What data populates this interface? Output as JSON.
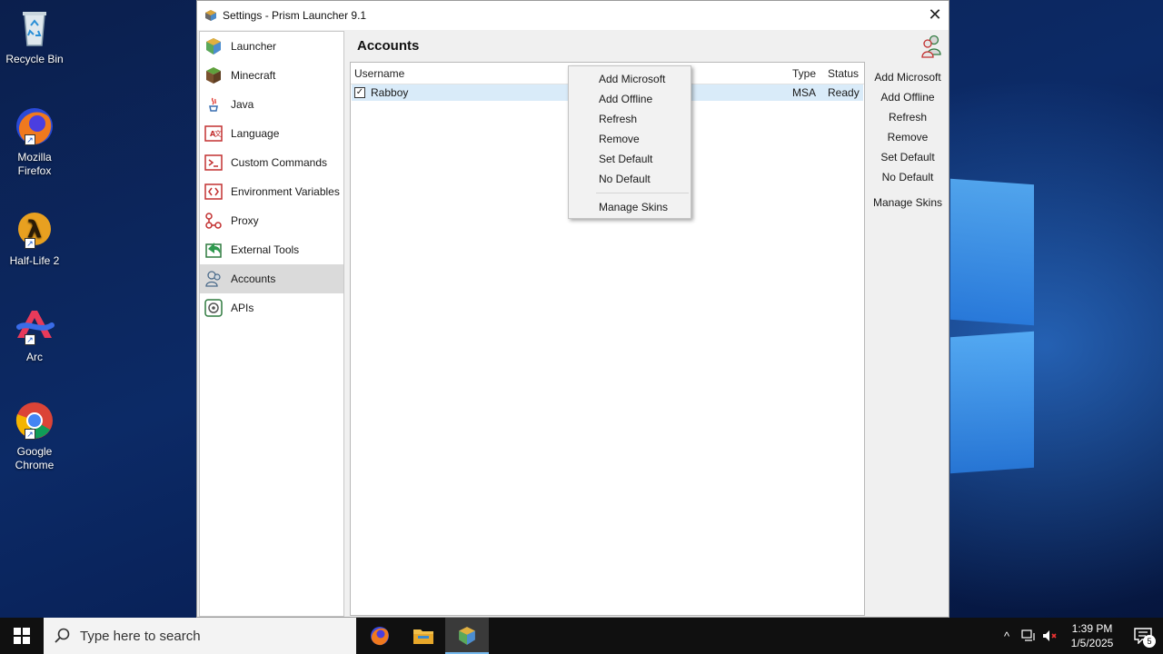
{
  "desktop": {
    "icons": [
      {
        "label": "Recycle Bin",
        "icon": "recycle-bin-icon"
      },
      {
        "label": "Mozilla Firefox",
        "icon": "firefox-icon"
      },
      {
        "label": "Half-Life 2",
        "icon": "half-life-icon"
      },
      {
        "label": "Arc",
        "icon": "arc-icon"
      },
      {
        "label": "Google Chrome",
        "icon": "chrome-icon"
      }
    ]
  },
  "window": {
    "title": "Settings - Prism Launcher 9.1",
    "close_glyph": "✕"
  },
  "sidebar": {
    "items": [
      {
        "label": "Launcher",
        "icon": "launcher-icon"
      },
      {
        "label": "Minecraft",
        "icon": "minecraft-block-icon"
      },
      {
        "label": "Java",
        "icon": "java-icon"
      },
      {
        "label": "Language",
        "icon": "language-icon"
      },
      {
        "label": "Custom Commands",
        "icon": "terminal-icon"
      },
      {
        "label": "Environment Variables",
        "icon": "code-brackets-icon"
      },
      {
        "label": "Proxy",
        "icon": "proxy-icon"
      },
      {
        "label": "External Tools",
        "icon": "external-tools-icon"
      },
      {
        "label": "Accounts",
        "icon": "accounts-icon",
        "active": true
      },
      {
        "label": "APIs",
        "icon": "api-icon"
      }
    ]
  },
  "accounts": {
    "title": "Accounts",
    "columns": {
      "username": "Username",
      "type": "Type",
      "status": "Status"
    },
    "rows": [
      {
        "checked": true,
        "check_glyph": "✓",
        "username": "Rabboy",
        "type": "MSA",
        "status": "Ready"
      }
    ],
    "actions": {
      "add_microsoft": "Add Microsoft",
      "add_offline": "Add Offline",
      "refresh": "Refresh",
      "remove": "Remove",
      "set_default": "Set Default",
      "no_default": "No Default",
      "manage_skins": "Manage Skins"
    }
  },
  "context_menu": {
    "items": [
      "Add Microsoft",
      "Add Offline",
      "Refresh",
      "Remove",
      "Set Default",
      "No Default"
    ],
    "after_separator": "Manage Skins"
  },
  "taskbar": {
    "search_placeholder": "Type here to search",
    "time": "1:39 PM",
    "date": "1/5/2025",
    "notification_count": "5",
    "tray_chevron": "^"
  },
  "colors": {
    "selection": "#d9ebf9",
    "active_sidebar": "#dadada",
    "taskbar": "#101010",
    "accent": "#76b9ed"
  }
}
